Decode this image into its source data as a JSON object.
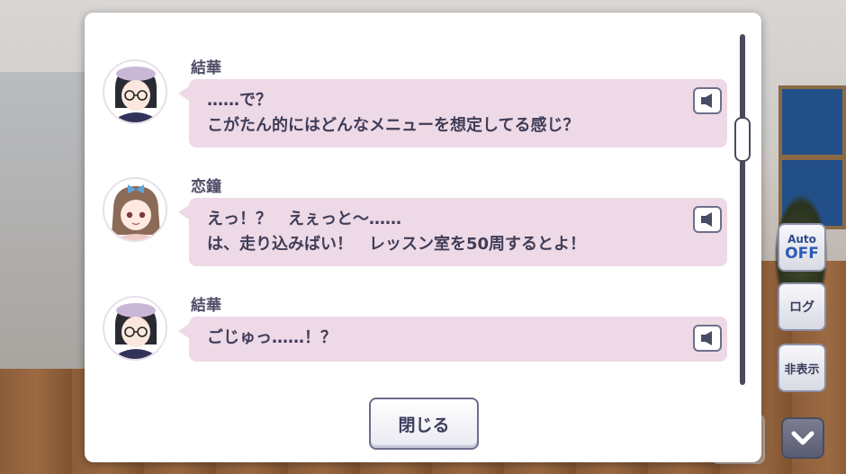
{
  "side_controls": {
    "auto_label_top": "Auto",
    "auto_label_bottom": "OFF",
    "log_label": "ログ",
    "hide_label": "非表示",
    "down_icon": "chevron-down-icon"
  },
  "log": {
    "entries": [
      {
        "speaker": "結華",
        "lines": [
          "……で？",
          "こがたん的にはどんなメニューを想定してる感じ？"
        ],
        "voice_icon": "speaker-icon"
      },
      {
        "speaker": "恋鐘",
        "lines": [
          "えっ！？　えぇっと～……",
          "は、走り込みばい！　レッスン室を50周するとよ！"
        ],
        "voice_icon": "speaker-icon"
      },
      {
        "speaker": "結華",
        "lines": [
          "ごじゅっ……！？"
        ],
        "voice_icon": "speaker-icon"
      }
    ],
    "close_label": "閉じる"
  },
  "colors": {
    "bubble": "#eed9e6",
    "text": "#3f3d58",
    "accent": "#2a5bb4"
  }
}
